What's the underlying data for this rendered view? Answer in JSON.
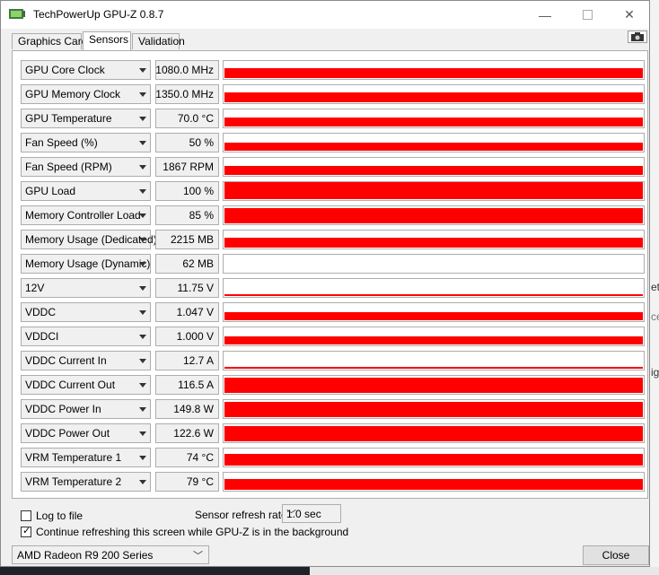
{
  "window": {
    "title": "TechPowerUp GPU-Z 0.8.7",
    "minimize": "—",
    "close": "✕"
  },
  "tabs": [
    "Graphics Card",
    "Sensors",
    "Validation"
  ],
  "active_tab": "Sensors",
  "sensors": [
    {
      "label": "GPU Core Clock",
      "value": "1080.0 MHz",
      "level": 0.55
    },
    {
      "label": "GPU Memory Clock",
      "value": "1350.0 MHz",
      "level": 0.55
    },
    {
      "label": "GPU Temperature",
      "value": "70.0 °C",
      "level": 0.5
    },
    {
      "label": "Fan Speed (%)",
      "value": "50 %",
      "level": 0.45
    },
    {
      "label": "Fan Speed (RPM)",
      "value": "1867 RPM",
      "level": 0.5
    },
    {
      "label": "GPU Load",
      "value": "100 %",
      "level": 0.95
    },
    {
      "label": "Memory Controller Load",
      "value": "85 %",
      "level": 0.85
    },
    {
      "label": "Memory Usage (Dedicated)",
      "value": "2215 MB",
      "level": 0.55
    },
    {
      "label": "Memory Usage (Dynamic)",
      "value": "62 MB",
      "level": 0.0
    },
    {
      "label": "12V",
      "value": "11.75 V",
      "level": 0.1
    },
    {
      "label": "VDDC",
      "value": "1.047 V",
      "level": 0.45
    },
    {
      "label": "VDDCI",
      "value": "1.000 V",
      "level": 0.45
    },
    {
      "label": "VDDC Current In",
      "value": "12.7 A",
      "level": 0.1
    },
    {
      "label": "VDDC Current Out",
      "value": "116.5 A",
      "level": 0.85
    },
    {
      "label": "VDDC Power In",
      "value": "149.8 W",
      "level": 0.85
    },
    {
      "label": "VDDC Power Out",
      "value": "122.6 W",
      "level": 0.85
    },
    {
      "label": "VRM Temperature 1",
      "value": "74 °C",
      "level": 0.65
    },
    {
      "label": "VRM Temperature 2",
      "value": "79 °C",
      "level": 0.6
    }
  ],
  "graph_color": "#ff0000",
  "options": {
    "log_to_file": {
      "label": "Log to file",
      "checked": false
    },
    "continue_refresh": {
      "label": "Continue refreshing this screen while GPU-Z is in the background",
      "checked": true
    },
    "refresh_rate_label": "Sensor refresh rate:",
    "refresh_rate_value": "1.0 sec"
  },
  "gpu_select": "AMD Radeon R9 200 Series",
  "close_button": "Close",
  "background_fragments": [
    "et",
    "ce",
    "ig"
  ]
}
